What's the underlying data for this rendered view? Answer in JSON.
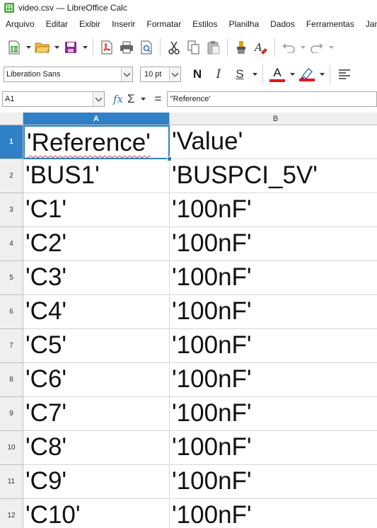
{
  "window": {
    "title": "video.csv — LibreOffice Calc"
  },
  "menu": [
    "Arquivo",
    "Editar",
    "Exibir",
    "Inserir",
    "Formatar",
    "Estilos",
    "Planilha",
    "Dados",
    "Ferramentas",
    "Janela"
  ],
  "toolbar": {
    "icons": [
      "new-spreadsheet-icon",
      "open-folder-icon",
      "save-icon",
      "export-pdf-icon",
      "print-icon",
      "print-preview-icon",
      "cut-icon",
      "copy-icon",
      "paste-icon",
      "clone-formatting-icon",
      "clear-formatting-icon",
      "undo-icon",
      "redo-icon"
    ]
  },
  "format_bar": {
    "font_name": "Liberation Sans",
    "font_size": "10 pt",
    "bold": "N",
    "italic": "I",
    "underline": "S",
    "font_color_glyph": "A",
    "accent_color": "#e8131a"
  },
  "formula_bar": {
    "name_box": "A1",
    "fx": "fx",
    "sigma": "Σ",
    "equals": "=",
    "content": "''Reference'"
  },
  "sheet": {
    "columns": [
      "A",
      "B"
    ],
    "selected_column": "A",
    "rows": [
      {
        "n": "1",
        "a": "'Reference'",
        "b": "'Value'"
      },
      {
        "n": "2",
        "a": "'BUS1'",
        "b": "'BUSPCI_5V'"
      },
      {
        "n": "3",
        "a": "'C1'",
        "b": "'100nF'"
      },
      {
        "n": "4",
        "a": "'C2'",
        "b": "'100nF'"
      },
      {
        "n": "5",
        "a": "'C3'",
        "b": "'100nF'"
      },
      {
        "n": "6",
        "a": "'C4'",
        "b": "'100nF'"
      },
      {
        "n": "7",
        "a": "'C5'",
        "b": "'100nF'"
      },
      {
        "n": "8",
        "a": "'C6'",
        "b": "'100nF'"
      },
      {
        "n": "9",
        "a": "'C7'",
        "b": "'100nF'"
      },
      {
        "n": "10",
        "a": "'C8'",
        "b": "'100nF'"
      },
      {
        "n": "11",
        "a": "'C9'",
        "b": "'100nF'"
      },
      {
        "n": "12",
        "a": "'C10'",
        "b": "'100nF'"
      }
    ],
    "selection_color": "#2f80c7"
  }
}
